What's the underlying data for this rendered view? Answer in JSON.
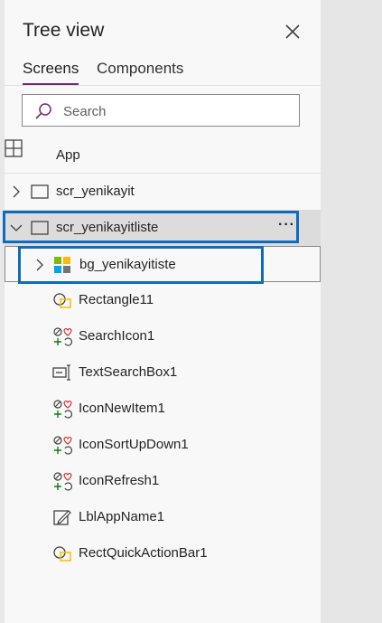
{
  "header": {
    "title": "Tree view"
  },
  "tabs": [
    {
      "label": "Screens"
    },
    {
      "label": "Components"
    }
  ],
  "search": {
    "placeholder": "Search"
  },
  "app": {
    "label": "App"
  },
  "screens": [
    {
      "label": "scr_yenikayit"
    },
    {
      "label": "scr_yenikayitliste"
    }
  ],
  "children": [
    {
      "label": "bg_yenikayitiste",
      "icon": "group-icon"
    },
    {
      "label": "Rectangle11",
      "icon": "shapes-icon"
    },
    {
      "label": "SearchIcon1",
      "icon": "icons-control-icon"
    },
    {
      "label": "TextSearchBox1",
      "icon": "text-input-icon"
    },
    {
      "label": "IconNewItem1",
      "icon": "icons-control-icon"
    },
    {
      "label": "IconSortUpDown1",
      "icon": "icons-control-icon"
    },
    {
      "label": "IconRefresh1",
      "icon": "icons-control-icon"
    },
    {
      "label": "LblAppName1",
      "icon": "label-icon"
    },
    {
      "label": "RectQuickActionBar1",
      "icon": "shapes-icon"
    }
  ],
  "more_label": "···"
}
